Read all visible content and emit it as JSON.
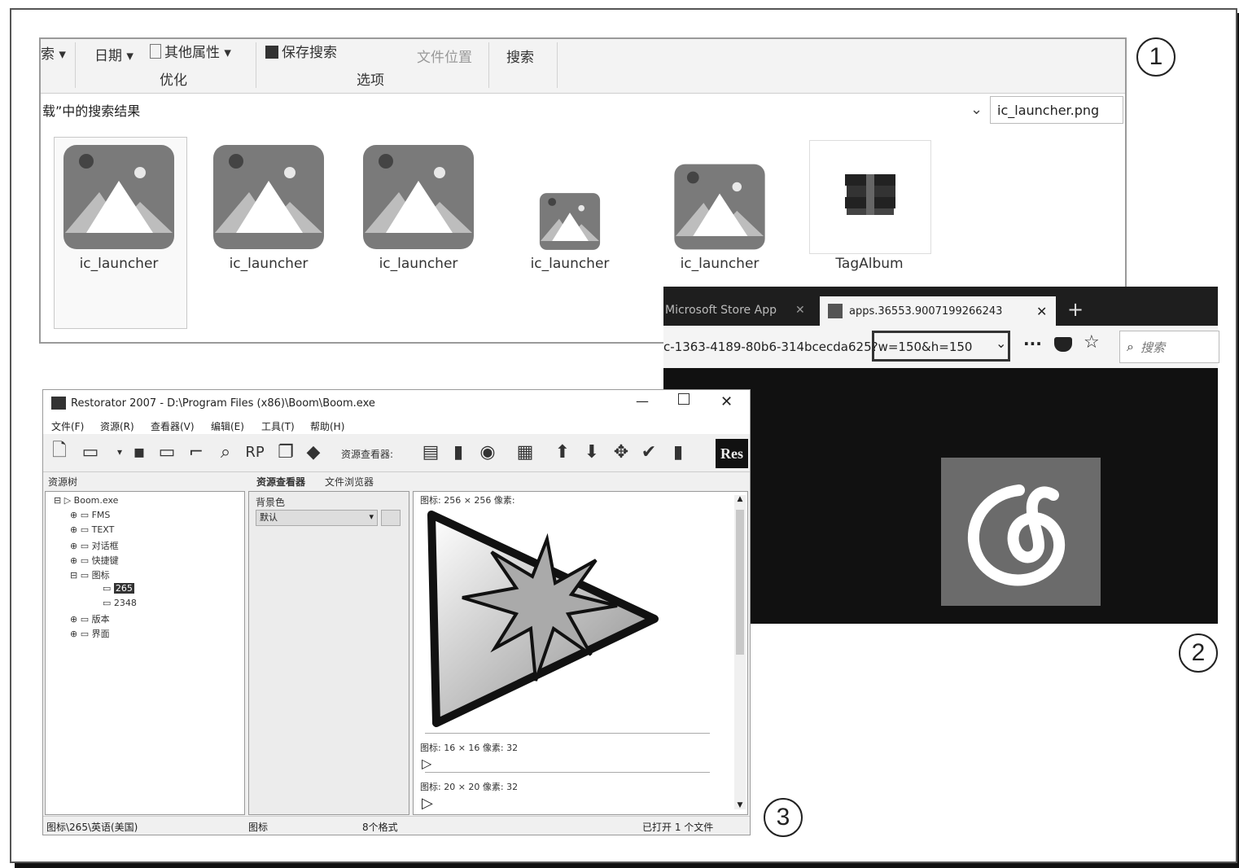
{
  "explorer": {
    "ribbon": {
      "search_item": "索 ▾",
      "date_item": "日期 ▾",
      "other_props": "其他属性 ▾",
      "save_search": "保存搜索",
      "file_location": "文件位置",
      "search_tab": "搜索",
      "group_optimize": "优化",
      "group_options": "选项"
    },
    "address_text": "载”中的搜索结果",
    "search_box_value": "ic_launcher.png",
    "files": [
      {
        "name": "ic_launcher"
      },
      {
        "name": "ic_launcher"
      },
      {
        "name": "ic_launcher"
      },
      {
        "name": "ic_launcher"
      },
      {
        "name": "ic_launcher"
      },
      {
        "name": "TagAlbum"
      }
    ]
  },
  "browser": {
    "tab1_label": "Microsoft Store App",
    "tab2_label": "apps.36553.9007199266243",
    "url_text": "c-1363-4189-80b6-314bcecda625?w=150&h=150",
    "search_placeholder": "搜索"
  },
  "restorator": {
    "title": "Restorator 2007 - D:\\Program Files (x86)\\Boom\\Boom.exe",
    "menu": [
      "文件(F)",
      "资源(R)",
      "查看器(V)",
      "编辑(E)",
      "工具(T)",
      "帮助(H)"
    ],
    "toolbar_viewer_label": "资源查看器:",
    "left_panel_header": "资源树",
    "tabs": [
      "资源查看器",
      "文件浏览器"
    ],
    "tree": [
      "Boom.exe",
      "FMS",
      "TEXT",
      "对话框",
      "快捷键",
      "图标",
      "265",
      "2348",
      "版本",
      "界面"
    ],
    "bg_label": "背景色",
    "bg_value": "默认",
    "preview_info_1": "图标: 256 × 256 像素: ",
    "preview_info_2": "图标: 16 × 16 像素: 32",
    "preview_info_3": "图标: 20 × 20 像素: 32",
    "status": [
      "图标\\265\\英语(美国)",
      "图标",
      "8个格式",
      "已打开 1 个文件"
    ],
    "logo": "Res"
  },
  "callouts": [
    "1",
    "2",
    "3"
  ]
}
